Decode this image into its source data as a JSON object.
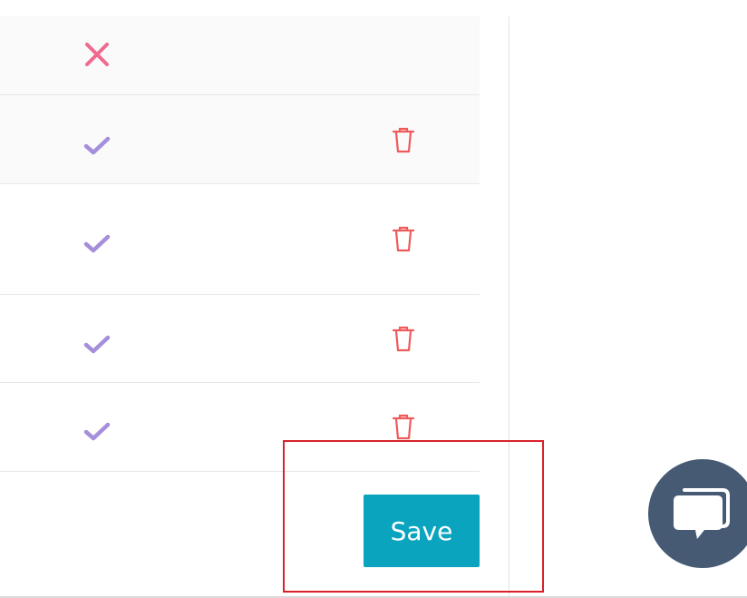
{
  "table": {
    "rows": [
      {
        "status": "cross",
        "status_icon": "x-mark-icon",
        "has_delete": false
      },
      {
        "status": "check",
        "status_icon": "checkmark-icon",
        "has_delete": true
      },
      {
        "status": "check",
        "status_icon": "checkmark-icon",
        "has_delete": true
      },
      {
        "status": "check",
        "status_icon": "checkmark-icon",
        "has_delete": true
      },
      {
        "status": "check",
        "status_icon": "checkmark-icon",
        "has_delete": true
      }
    ]
  },
  "actions": {
    "save_label": "Save"
  },
  "chat": {
    "icon": "chat-bubbles-icon"
  },
  "colors": {
    "cross": "#f06a8f",
    "check": "#a58fdc",
    "delete": "#ef5a5a",
    "save_bg": "#0ba4bf",
    "chat_bg": "#465a74",
    "highlight": "#d9222a"
  }
}
